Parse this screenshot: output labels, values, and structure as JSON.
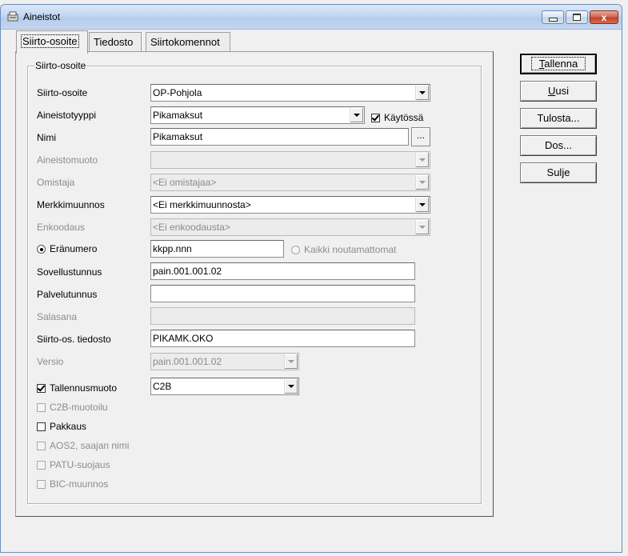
{
  "window": {
    "title": "Aineistot",
    "close_label": "x"
  },
  "tabs": [
    {
      "label": "Siirto-osoite",
      "active": true
    },
    {
      "label": "Tiedosto",
      "active": false
    },
    {
      "label": "Siirtokomennot",
      "active": false
    }
  ],
  "group": {
    "title": "Siirto-osoite"
  },
  "form": {
    "siirto_osoite": {
      "label": "Siirto-osoite",
      "value": "OP-Pohjola"
    },
    "aineistotyyppi": {
      "label": "Aineistotyyppi",
      "value": "Pikamaksut"
    },
    "kaytossa": {
      "label": "Käytössä",
      "checked": true
    },
    "nimi": {
      "label": "Nimi",
      "value": "Pikamaksut",
      "browse_label": "..."
    },
    "aineistomuoto": {
      "label": "Aineistomuoto",
      "value": ""
    },
    "omistaja": {
      "label": "Omistaja",
      "value": "<Ei omistajaa>"
    },
    "merkkimuunnos": {
      "label": "Merkkimuunnos",
      "value": "<Ei merkkimuunnosta>"
    },
    "enkoodaus": {
      "label": "Enkoodaus",
      "value": "<Ei enkoodausta>"
    },
    "eranumero": {
      "label": "Eränumero",
      "value": "kkpp.nnn",
      "selected": true
    },
    "kaikki_noutamattomat": {
      "label": "Kaikki noutamattomat",
      "selected": false
    },
    "sovellustunnus": {
      "label": "Sovellustunnus",
      "value": "pain.001.001.02"
    },
    "palvelutunnus": {
      "label": "Palvelutunnus",
      "value": ""
    },
    "salasana": {
      "label": "Salasana",
      "value": ""
    },
    "siirto_os_tiedosto": {
      "label": "Siirto-os. tiedosto",
      "value": "PIKAMK.OKO"
    },
    "versio": {
      "label": "Versio",
      "value": "pain.001.001.02"
    },
    "tallennusmuoto": {
      "label": "Tallennusmuoto",
      "checked": true,
      "value": "C2B"
    },
    "c2b_muotoilu": {
      "label": "C2B-muotoilu",
      "checked": false
    },
    "pakkaus": {
      "label": "Pakkaus",
      "checked": false
    },
    "aos2": {
      "label": "AOS2, saajan nimi",
      "checked": false
    },
    "patu": {
      "label": "PATU-suojaus",
      "checked": false
    },
    "bic": {
      "label": "BIC-muunnos",
      "checked": false
    }
  },
  "buttons": {
    "tallenna": {
      "first": "T",
      "rest": "allenna"
    },
    "uusi": {
      "first": "U",
      "rest": "usi"
    },
    "tulosta": "Tulosta...",
    "dos": "Dos...",
    "sulje": "Sulje"
  }
}
